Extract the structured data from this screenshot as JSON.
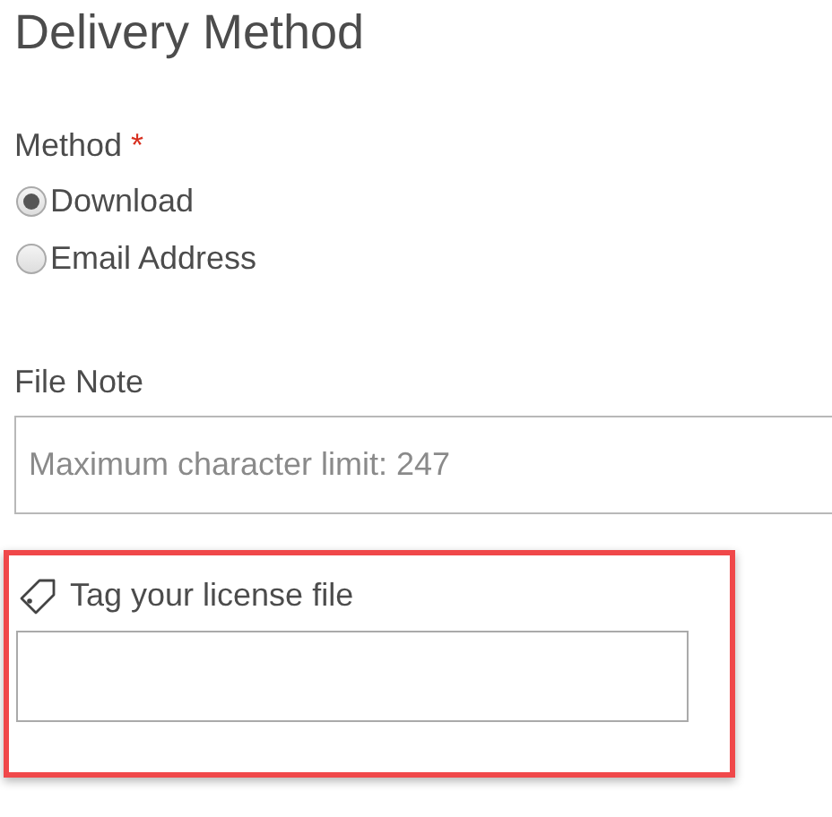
{
  "title": "Delivery Method",
  "method": {
    "label": "Method",
    "required_mark": "*",
    "options": [
      {
        "label": "Download",
        "selected": true
      },
      {
        "label": "Email Address",
        "selected": false
      }
    ]
  },
  "file_note": {
    "label": "File Note",
    "placeholder": "Maximum character limit: 247"
  },
  "tag": {
    "label": "Tag your license file",
    "highlighted": true
  }
}
